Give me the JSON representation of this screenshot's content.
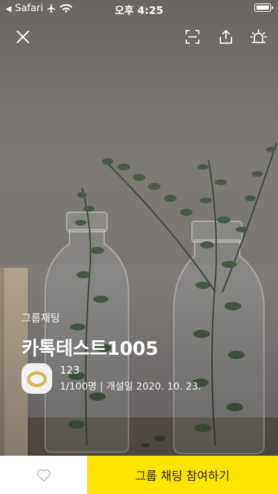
{
  "status_bar": {
    "back_app": "Safari",
    "time": "오후 4:25"
  },
  "toolbar": {
    "icons": [
      "close-icon",
      "qr-scan-icon",
      "share-icon",
      "report-siren-icon"
    ]
  },
  "profile": {
    "category": "그룹채팅",
    "title": "카톡테스트1005",
    "owner_name": "123",
    "members_and_date": "1/100명 | 개설일 2020. 10. 23."
  },
  "bottom_bar": {
    "like_icon": "heart-outline-icon",
    "join_label": "그룹 채팅 참여하기",
    "join_color": "#fee500"
  }
}
